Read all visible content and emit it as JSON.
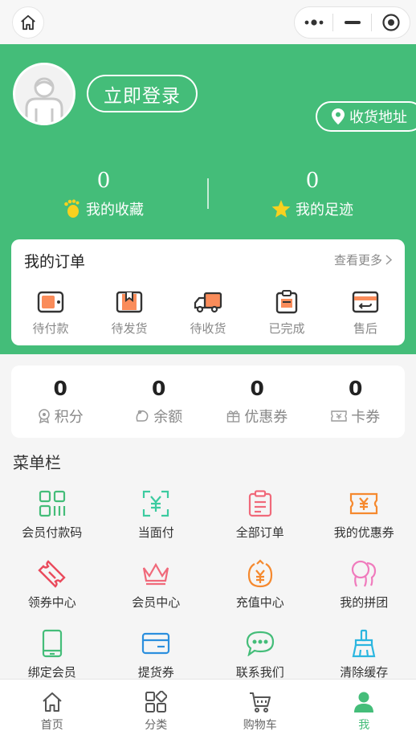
{
  "colors": {
    "primary": "#44bd79",
    "order_icon": "#fa8c5a"
  },
  "header": {
    "login_label": "立即登录",
    "address_label": "收货地址",
    "stats": [
      {
        "value": "0",
        "label": "我的收藏",
        "icon": "footprint-icon"
      },
      {
        "value": "0",
        "label": "我的足迹",
        "icon": "star-icon"
      }
    ]
  },
  "orders": {
    "title": "我的订单",
    "more": "查看更多",
    "items": [
      {
        "label": "待付款",
        "icon": "wallet-icon"
      },
      {
        "label": "待发货",
        "icon": "package-icon"
      },
      {
        "label": "待收货",
        "icon": "truck-icon"
      },
      {
        "label": "已完成",
        "icon": "clipboard-icon"
      },
      {
        "label": "售后",
        "icon": "return-card-icon"
      }
    ]
  },
  "assets": [
    {
      "value": "0",
      "label": "积分",
      "icon": "points-icon"
    },
    {
      "value": "0",
      "label": "余额",
      "icon": "balance-icon"
    },
    {
      "value": "0",
      "label": "优惠券",
      "icon": "gift-icon"
    },
    {
      "value": "0",
      "label": "卡券",
      "icon": "ticket-icon"
    }
  ],
  "menu": {
    "title": "菜单栏",
    "items": [
      {
        "label": "会员付款码",
        "icon": "qr-code-icon"
      },
      {
        "label": "当面付",
        "icon": "scan-pay-icon"
      },
      {
        "label": "全部订单",
        "icon": "order-list-icon"
      },
      {
        "label": "我的优惠券",
        "icon": "coupon-icon"
      },
      {
        "label": "领券中心",
        "icon": "voucher-icon"
      },
      {
        "label": "会员中心",
        "icon": "crown-icon"
      },
      {
        "label": "充值中心",
        "icon": "recharge-icon"
      },
      {
        "label": "我的拼团",
        "icon": "group-icon"
      },
      {
        "label": "绑定会员",
        "icon": "phone-icon"
      },
      {
        "label": "提货券",
        "icon": "card-icon"
      },
      {
        "label": "联系我们",
        "icon": "chat-icon"
      },
      {
        "label": "清除缓存",
        "icon": "broom-icon"
      }
    ]
  },
  "tabbar": [
    {
      "label": "首页",
      "icon": "home-icon"
    },
    {
      "label": "分类",
      "icon": "category-icon"
    },
    {
      "label": "购物车",
      "icon": "cart-icon"
    },
    {
      "label": "我",
      "icon": "user-icon",
      "active": true
    }
  ]
}
